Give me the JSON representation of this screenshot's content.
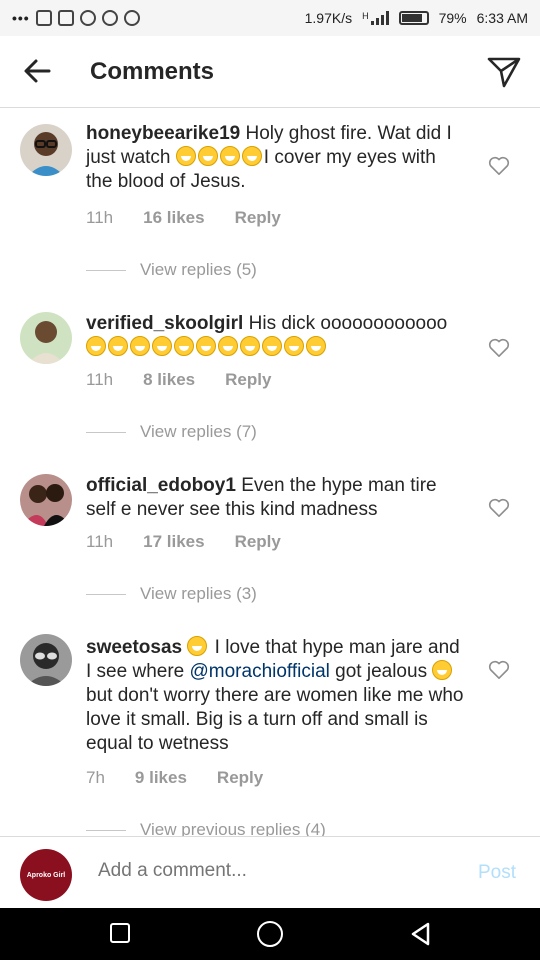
{
  "status_bar": {
    "dots": "•••",
    "network_speed": "1.97K/s",
    "signal_label": "H",
    "battery": "79%",
    "time": "6:33 AM"
  },
  "header": {
    "title": "Comments",
    "back_icon": "back-arrow-icon",
    "share_icon": "paper-plane-icon"
  },
  "comments": [
    {
      "username": "honeybeearike19",
      "text_before": "Holy ghost fire. Wat did I just watch ",
      "emoji_count": 4,
      "text_after": "I cover my eyes with the blood of Jesus.",
      "time": "11h",
      "likes": "16 likes",
      "reply": "Reply",
      "view_replies": "View replies (5)"
    },
    {
      "username": "verified_skoolgirl",
      "text_before": "His dick oooooooooooo ",
      "emoji_count": 11,
      "text_after": "",
      "time": "11h",
      "likes": "8 likes",
      "reply": "Reply",
      "view_replies": "View replies (7)"
    },
    {
      "username": "official_edoboy1",
      "text_before": "Even the hype man tire self e never see this kind madness",
      "emoji_count": 0,
      "text_after": "",
      "time": "11h",
      "likes": "17 likes",
      "reply": "Reply",
      "view_replies": "View replies (3)"
    },
    {
      "username": "sweetosas",
      "text_before": " I love that hype man jare and I see where ",
      "mention": "@morachiofficial",
      "text_mid": " got jealous ",
      "text_after": " but don't worry there are women like me who love it small. Big is a turn off and small is equal to wetness",
      "time": "7h",
      "likes": "9 likes",
      "reply": "Reply",
      "view_replies": "View previous replies (4)"
    }
  ],
  "add_comment": {
    "placeholder": "Add a comment...",
    "post_label": "Post",
    "avatar_text": "Aproko Girl"
  },
  "colors": {
    "accent_blue": "#b2dffc",
    "mention": "#003569",
    "meta_gray": "#999999"
  }
}
